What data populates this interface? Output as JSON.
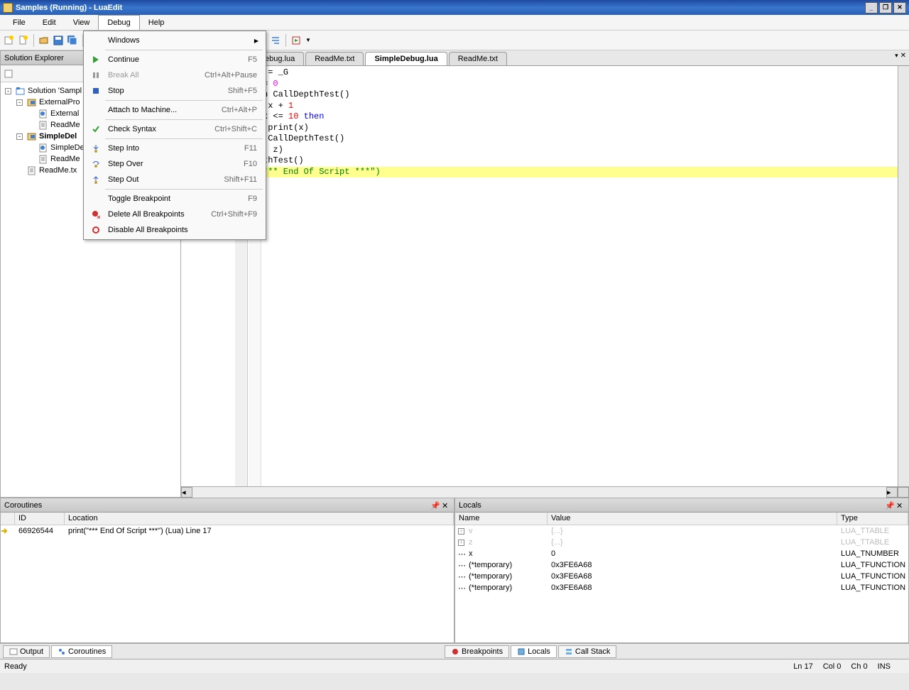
{
  "title": "Samples (Running) - LuaEdit",
  "menus": {
    "file": "File",
    "edit": "Edit",
    "view": "View",
    "debug": "Debug",
    "help": "Help"
  },
  "debugMenu": [
    {
      "label": "Windows",
      "shortcut": "",
      "arrow": true,
      "sep": false
    },
    {
      "sep": true
    },
    {
      "label": "Continue",
      "shortcut": "F5",
      "icon": "play"
    },
    {
      "label": "Break All",
      "shortcut": "Ctrl+Alt+Pause",
      "icon": "pause",
      "disabled": true
    },
    {
      "label": "Stop",
      "shortcut": "Shift+F5",
      "icon": "stop"
    },
    {
      "sep": true
    },
    {
      "label": "Attach to Machine...",
      "shortcut": "Ctrl+Alt+P"
    },
    {
      "sep": true
    },
    {
      "label": "Check Syntax",
      "shortcut": "Ctrl+Shift+C",
      "icon": "check"
    },
    {
      "sep": true
    },
    {
      "label": "Step Into",
      "shortcut": "F11",
      "icon": "stepinto"
    },
    {
      "label": "Step Over",
      "shortcut": "F10",
      "icon": "stepover"
    },
    {
      "label": "Step Out",
      "shortcut": "Shift+F11",
      "icon": "stepout"
    },
    {
      "sep": true
    },
    {
      "label": "Toggle Breakpoint",
      "shortcut": "F9"
    },
    {
      "label": "Delete All Breakpoints",
      "shortcut": "Ctrl+Shift+F9",
      "icon": "bpdel"
    },
    {
      "label": "Disable All Breakpoints",
      "shortcut": "",
      "icon": "bpdis"
    }
  ],
  "solExplorer": {
    "title": "Solution Explorer",
    "tree": [
      {
        "indent": 0,
        "exp": "-",
        "icon": "sol",
        "label": "Solution 'Sampl",
        "bold": false
      },
      {
        "indent": 1,
        "exp": "-",
        "icon": "proj",
        "label": "ExternalPro",
        "bold": false
      },
      {
        "indent": 2,
        "exp": "",
        "icon": "lua",
        "label": "External",
        "bold": false
      },
      {
        "indent": 2,
        "exp": "",
        "icon": "txt",
        "label": "ReadMe",
        "bold": false
      },
      {
        "indent": 1,
        "exp": "-",
        "icon": "proj",
        "label": "SimpleDel",
        "bold": true
      },
      {
        "indent": 2,
        "exp": "",
        "icon": "lua",
        "label": "SimpleDe",
        "bold": false
      },
      {
        "indent": 2,
        "exp": "",
        "icon": "txt",
        "label": "ReadMe",
        "bold": false
      },
      {
        "indent": 1,
        "exp": "",
        "icon": "txt",
        "label": "ReadMe.tx",
        "bold": false
      }
    ]
  },
  "tabs": [
    {
      "label": "ebug.lua",
      "active": false
    },
    {
      "label": "ReadMe.txt",
      "active": false
    },
    {
      "label": "SimpleDebug.lua",
      "active": true
    },
    {
      "label": "ReadMe.txt",
      "active": false
    }
  ],
  "code": {
    "lines": [
      {
        "t": " = _G"
      },
      {
        "t": "= ",
        "mag": "0"
      },
      {
        "t": ""
      },
      {
        "t": "n CallDepthTest()",
        "kw0": "n "
      },
      {
        "t": " x + ",
        "num": "1"
      },
      {
        "t": "x <= ",
        "num2": "10",
        "kw": " then"
      },
      {
        "t": " print(x)"
      },
      {
        "t": " CallDepthTest()"
      },
      {
        "t": ""
      },
      {
        "t": ""
      },
      {
        "t": ""
      },
      {
        "t": ", z)"
      },
      {
        "t": "thTest()"
      },
      {
        "t": "",
        "str": "*** End Of Script ***\")",
        "hl": true
      }
    ]
  },
  "coroutines": {
    "title": "Coroutines",
    "cols": {
      "id": "ID",
      "loc": "Location"
    },
    "rows": [
      {
        "id": "66926544",
        "loc": "print(\"*** End Of Script ***\")   (Lua)   Line 17"
      }
    ]
  },
  "locals": {
    "title": "Locals",
    "cols": {
      "name": "Name",
      "value": "Value",
      "type": "Type"
    },
    "rows": [
      {
        "name": "v",
        "value": "{...}",
        "type": "LUA_TTABLE",
        "faded": true,
        "exp": "+"
      },
      {
        "name": "z",
        "value": "{...}",
        "type": "LUA_TTABLE",
        "faded": true,
        "exp": "+"
      },
      {
        "name": "x",
        "value": "0",
        "type": "LUA_TNUMBER",
        "exp": ""
      },
      {
        "name": "(*temporary)",
        "value": "0x3FE6A68",
        "type": "LUA_TFUNCTION",
        "exp": ""
      },
      {
        "name": "(*temporary)",
        "value": "0x3FE6A68",
        "type": "LUA_TFUNCTION",
        "exp": ""
      },
      {
        "name": "(*temporary)",
        "value": "0x3FE6A68",
        "type": "LUA_TFUNCTION",
        "exp": ""
      }
    ]
  },
  "bottomTabs": {
    "left": [
      {
        "label": "Output",
        "sel": false
      },
      {
        "label": "Coroutines",
        "sel": true
      }
    ],
    "right": [
      {
        "label": "Breakpoints",
        "sel": false
      },
      {
        "label": "Locals",
        "sel": true
      },
      {
        "label": "Call Stack",
        "sel": false
      }
    ]
  },
  "status": {
    "ready": "Ready",
    "ln": "Ln 17",
    "col": "Col 0",
    "ch": "Ch 0",
    "ins": "INS"
  }
}
